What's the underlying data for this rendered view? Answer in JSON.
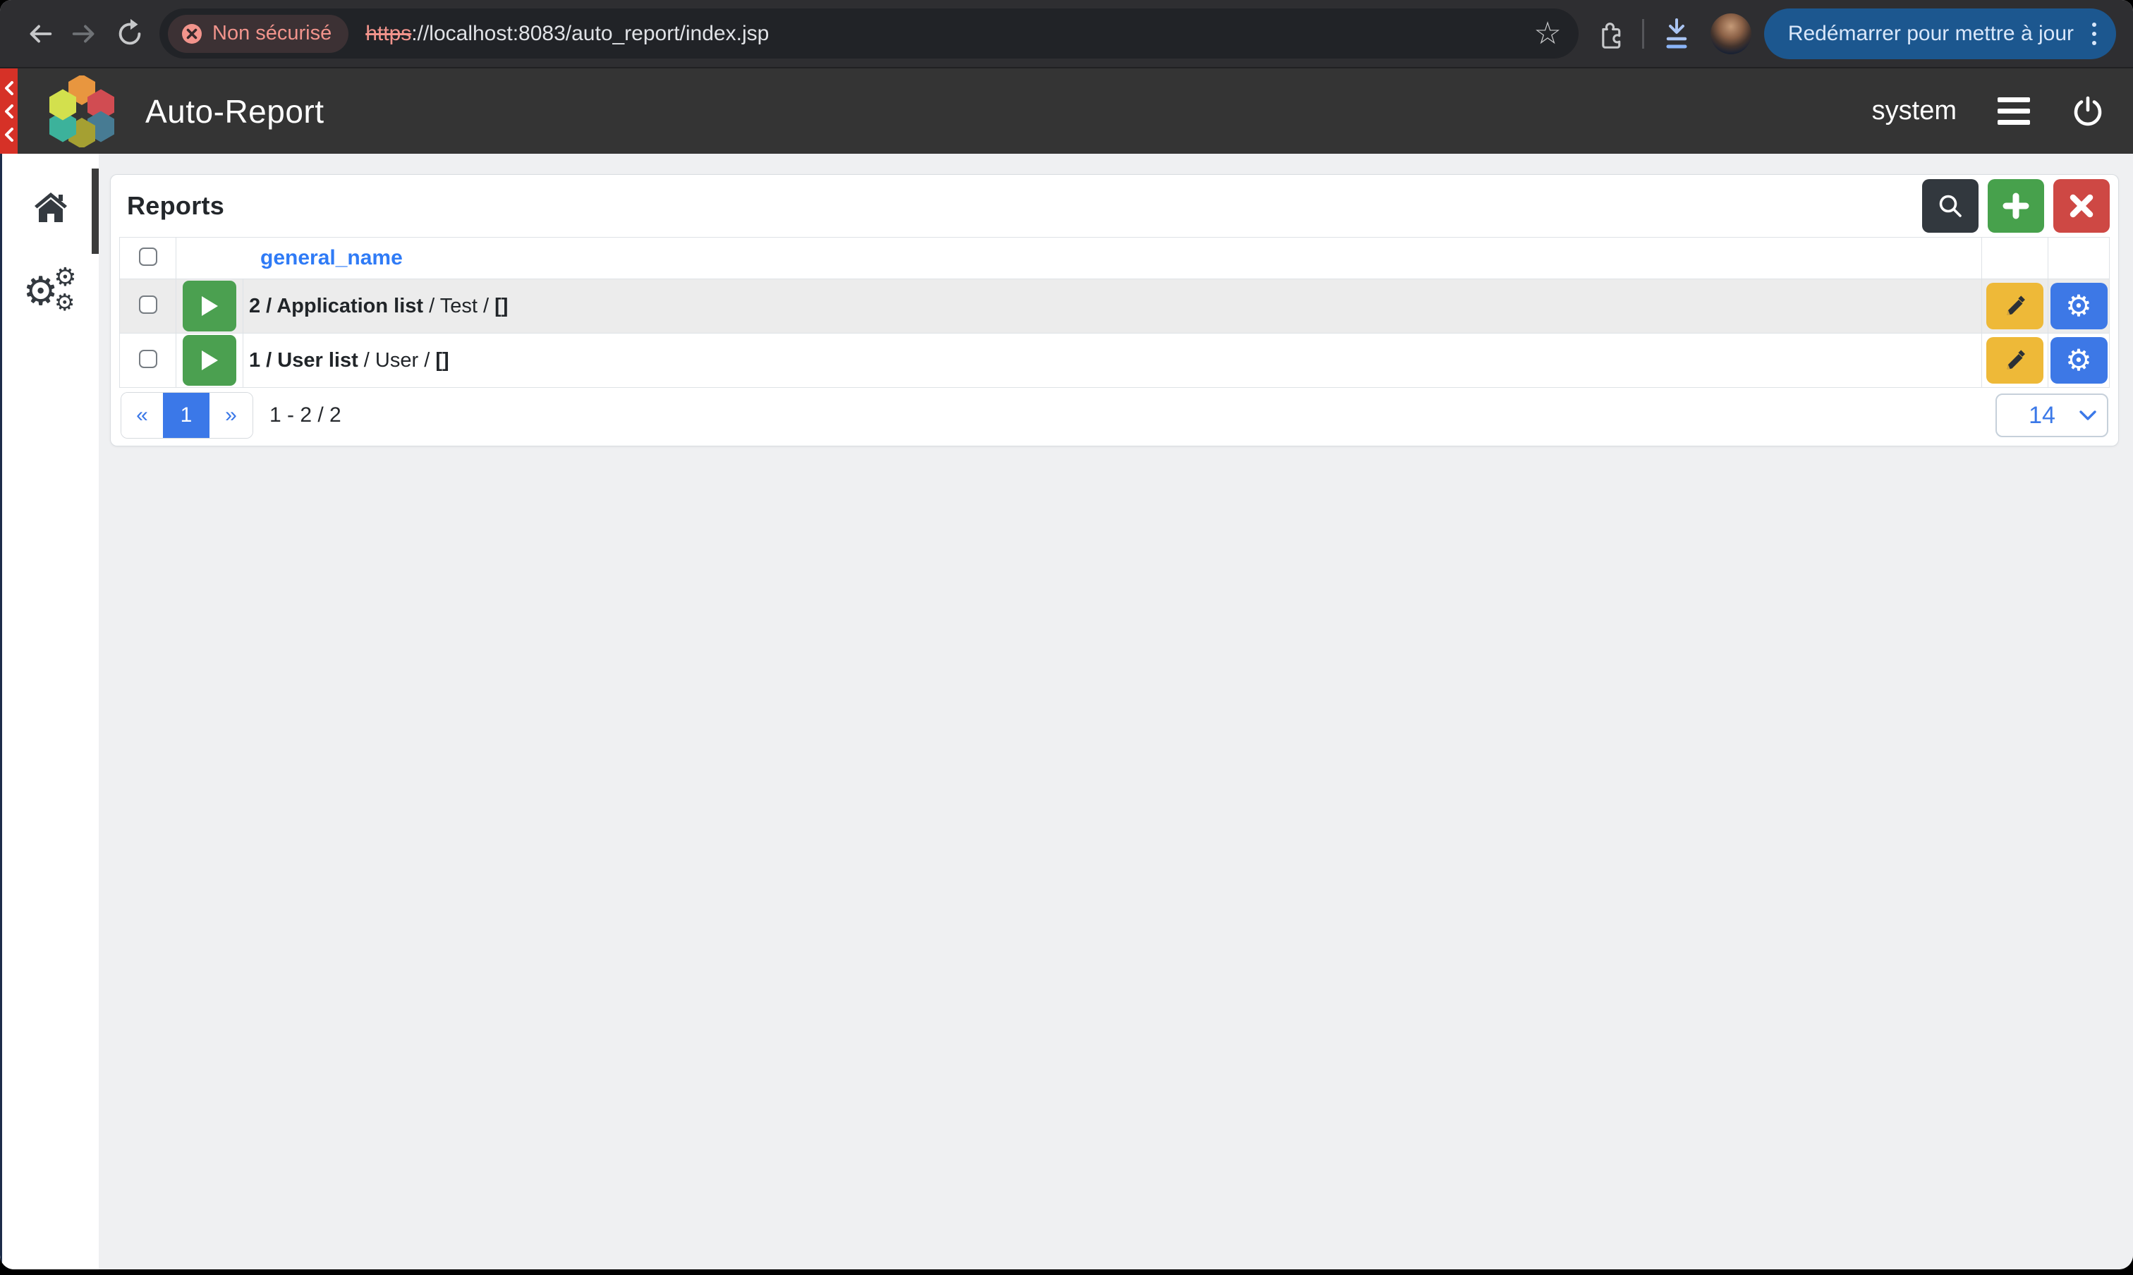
{
  "browser": {
    "security_chip": "Non sécurisé",
    "url_scheme": "https",
    "url_rest": "://localhost:8083/auto_report/index.jsp",
    "restart_button": "Redémarrer pour mettre à jour"
  },
  "header": {
    "app_title": "Auto-Report",
    "username": "system"
  },
  "reports": {
    "title": "Reports",
    "column_header": "general_name",
    "rows": [
      {
        "name_bold": "2 / Application list",
        "name_mid": " / Test / ",
        "name_suffix": "[]"
      },
      {
        "name_bold": "1 / User list",
        "name_mid": " / User / ",
        "name_suffix": "[]"
      }
    ],
    "pagination": {
      "prev": "«",
      "current_page": "1",
      "next": "»",
      "summary": "1 - 2 / 2",
      "page_size": "14"
    }
  },
  "icons": {
    "bookmark_star": "☆",
    "settings_gears": "⚙",
    "insecure_badge": "circle-x",
    "row_action_1": "pencil-icon",
    "row_action_2": "gear-icon",
    "run_report": "play-icon"
  },
  "colors": {
    "chrome_toolbar": "#2e2e31",
    "omnibox": "#212327",
    "insecure_red": "#f2948c",
    "restart_blue": "#1c578f",
    "app_header": "#343434",
    "collapse_strip_red": "#d63127",
    "link_blue": "#2f7bf6",
    "primary_blue": "#3b78e8",
    "success_green": "#47a14c",
    "danger_red": "#ce4844",
    "warning_yellow": "#eeb938",
    "dark_button": "#32383e",
    "row_stripe": "#ececec"
  }
}
